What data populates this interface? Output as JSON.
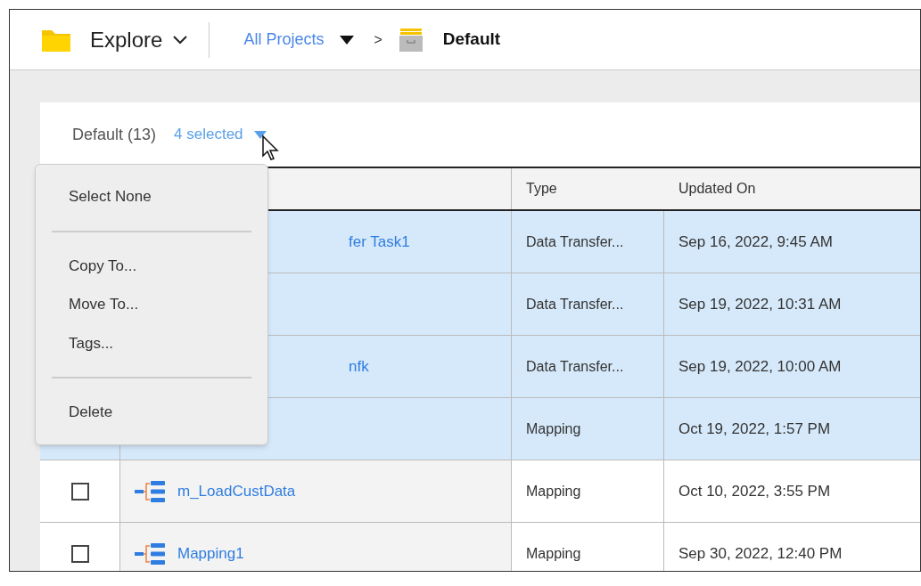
{
  "header": {
    "section": "Explore",
    "breadcrumb": {
      "parent": "All Projects",
      "separator": ">",
      "current": "Default"
    }
  },
  "list_header": {
    "title": "Default (13)",
    "selection": "4 selected"
  },
  "table": {
    "columns": [
      "Type",
      "Updated On"
    ],
    "rows": [
      {
        "selected": true,
        "name": "fer Task1",
        "type": "Data Transfer...",
        "updated": "Sep 16, 2022, 9:45 AM"
      },
      {
        "selected": true,
        "type": "Data Transfer...",
        "updated": "Sep 19, 2022, 10:31 AM"
      },
      {
        "selected": true,
        "name": "nfk",
        "type": "Data Transfer...",
        "updated": "Sep 19, 2022, 10:00 AM"
      },
      {
        "selected": true,
        "type": "Mapping",
        "updated": "Oct 19, 2022, 1:57 PM"
      },
      {
        "selected": false,
        "checked": false,
        "kind": "mapping",
        "name": "m_LoadCustData",
        "type": "Mapping",
        "updated": "Oct 10, 2022, 3:55 PM"
      },
      {
        "selected": false,
        "checked": false,
        "kind": "mapping",
        "name": "Mapping1",
        "type": "Mapping",
        "updated": "Sep 30, 2022, 12:40 PM"
      }
    ]
  },
  "menu": {
    "groups": [
      [
        "Select None"
      ],
      [
        "Copy To...",
        "Move To...",
        "Tags..."
      ],
      [
        "Delete"
      ]
    ]
  }
}
